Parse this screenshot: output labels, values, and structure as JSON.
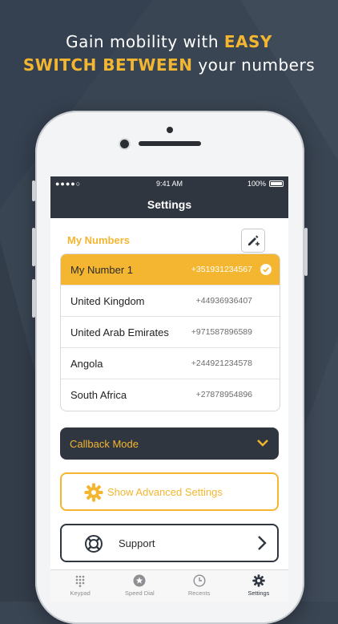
{
  "promo": {
    "line1_prefix": "Gain mobility with ",
    "line1_highlight": "EASY",
    "line2_highlight": "SWITCH BETWEEN",
    "line2_suffix": " your numbers"
  },
  "status_bar": {
    "signal": "●●●●○",
    "time": "9:41 AM",
    "battery": "100%"
  },
  "nav": {
    "title": "Settings"
  },
  "my_numbers": {
    "title": "My Numbers",
    "items": [
      {
        "name": "My Number 1",
        "number": "+351931234567",
        "selected": true
      },
      {
        "name": "United Kingdom",
        "number": "+44936936407",
        "selected": false
      },
      {
        "name": "United Arab Emirates",
        "number": "+971587896589",
        "selected": false
      },
      {
        "name": "Angola",
        "number": "+244921234578",
        "selected": false
      },
      {
        "name": "South Africa",
        "number": "+27878954896",
        "selected": false
      }
    ]
  },
  "callback": {
    "label": "Callback Mode"
  },
  "advanced": {
    "label": "Show Advanced Settings"
  },
  "support": {
    "label": "Support"
  },
  "tabs": [
    {
      "label": "Keypad",
      "icon": "keypad-icon"
    },
    {
      "label": "Speed Dial",
      "icon": "star-icon"
    },
    {
      "label": "Recents",
      "icon": "clock-icon"
    },
    {
      "label": "Settings",
      "icon": "gear-icon",
      "active": true
    }
  ],
  "colors": {
    "accent": "#f4b630",
    "dark": "#2f3640",
    "background": "#3a4553"
  }
}
